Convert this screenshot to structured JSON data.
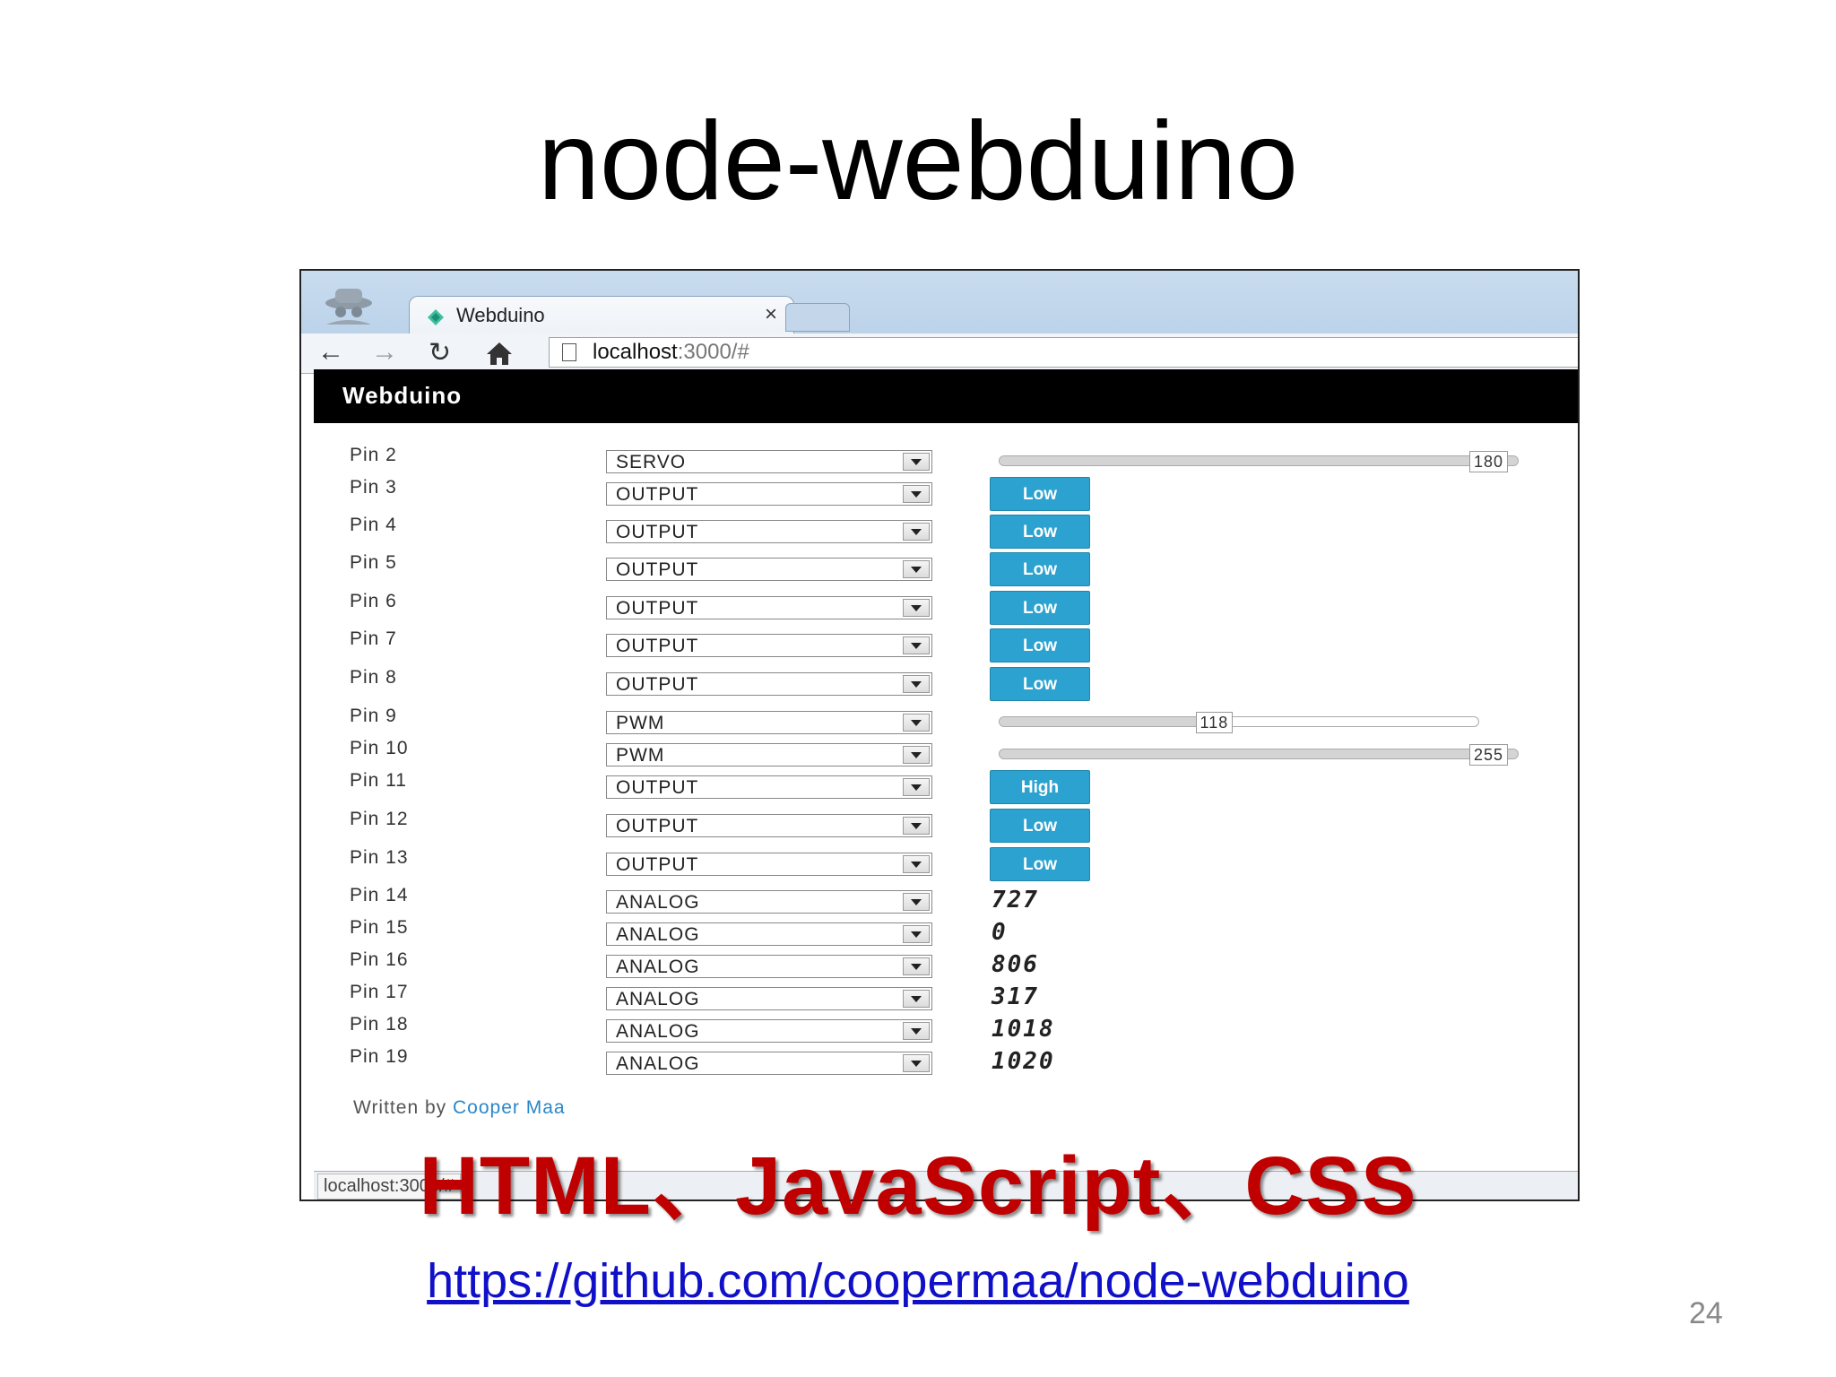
{
  "slide": {
    "title": "node-webduino",
    "overlay_caption": "HTML、JavaScript、CSS",
    "repo_link": "https://github.com/coopermaa/node-webduino",
    "page_number": "24"
  },
  "browser": {
    "tab_title": "Webduino",
    "tab_close": "×",
    "url_host": "localhost",
    "url_rest": ":3000/#",
    "status_text": "localhost:3000/#"
  },
  "app": {
    "brand": "Webduino",
    "footer_prefix": "Written by",
    "footer_author": "Cooper Maa",
    "button_color": "#2ba2cf",
    "pins": [
      {
        "label": "Pin 2",
        "mode": "SERVO",
        "control": "slider",
        "value": "180",
        "fraction": 1.0
      },
      {
        "label": "Pin 3",
        "mode": "OUTPUT",
        "control": "button",
        "value": "Low"
      },
      {
        "label": "Pin 4",
        "mode": "OUTPUT",
        "control": "button",
        "value": "Low"
      },
      {
        "label": "Pin 5",
        "mode": "OUTPUT",
        "control": "button",
        "value": "Low"
      },
      {
        "label": "Pin 6",
        "mode": "OUTPUT",
        "control": "button",
        "value": "Low"
      },
      {
        "label": "Pin 7",
        "mode": "OUTPUT",
        "control": "button",
        "value": "Low"
      },
      {
        "label": "Pin 8",
        "mode": "OUTPUT",
        "control": "button",
        "value": "Low"
      },
      {
        "label": "Pin 9",
        "mode": "PWM",
        "control": "slider",
        "value": "118",
        "fraction": 0.46
      },
      {
        "label": "Pin 10",
        "mode": "PWM",
        "control": "slider",
        "value": "255",
        "fraction": 1.0
      },
      {
        "label": "Pin 11",
        "mode": "OUTPUT",
        "control": "button",
        "value": "High"
      },
      {
        "label": "Pin 12",
        "mode": "OUTPUT",
        "control": "button",
        "value": "Low"
      },
      {
        "label": "Pin 13",
        "mode": "OUTPUT",
        "control": "button",
        "value": "Low"
      },
      {
        "label": "Pin 14",
        "mode": "ANALOG",
        "control": "analog",
        "value": "727"
      },
      {
        "label": "Pin 15",
        "mode": "ANALOG",
        "control": "analog",
        "value": "0"
      },
      {
        "label": "Pin 16",
        "mode": "ANALOG",
        "control": "analog",
        "value": "806"
      },
      {
        "label": "Pin 17",
        "mode": "ANALOG",
        "control": "analog",
        "value": "317"
      },
      {
        "label": "Pin 18",
        "mode": "ANALOG",
        "control": "analog",
        "value": "1018"
      },
      {
        "label": "Pin 19",
        "mode": "ANALOG",
        "control": "analog",
        "value": "1020"
      }
    ]
  }
}
